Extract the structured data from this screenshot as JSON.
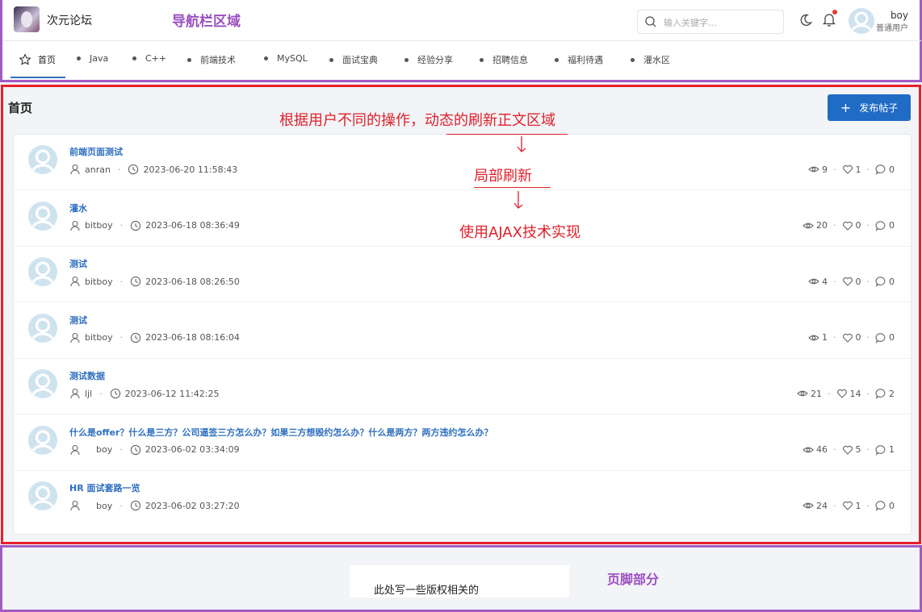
{
  "header": {
    "site_name": "次元论坛",
    "annotation": "导航栏区域",
    "search_placeholder": "输入关键字...",
    "user_name": "boy",
    "user_role": "普通用户"
  },
  "nav": {
    "items": [
      {
        "label": "首页",
        "active": true
      },
      {
        "label": "Java"
      },
      {
        "label": "C++"
      },
      {
        "label": "前端技术"
      },
      {
        "label": "MySQL"
      },
      {
        "label": "面试宝典"
      },
      {
        "label": "经验分享"
      },
      {
        "label": "招聘信息"
      },
      {
        "label": "福利待遇"
      },
      {
        "label": "灌水区"
      }
    ]
  },
  "main": {
    "page_title": "首页",
    "publish_label": "发布帖子",
    "posts": [
      {
        "title": "前端页面测试",
        "author": "anran",
        "time": "2023-06-20 11:58:43",
        "views": "9",
        "likes": "1",
        "comments": "0"
      },
      {
        "title": "灌水",
        "author": "bitboy",
        "time": "2023-06-18 08:36:49",
        "views": "20",
        "likes": "0",
        "comments": "0"
      },
      {
        "title": "测试",
        "author": "bitboy",
        "time": "2023-06-18 08:26:50",
        "views": "4",
        "likes": "0",
        "comments": "0"
      },
      {
        "title": "测试",
        "author": "bitboy",
        "time": "2023-06-18 08:16:04",
        "views": "1",
        "likes": "0",
        "comments": "0"
      },
      {
        "title": "测试数据",
        "author": "ljl",
        "time": "2023-06-12 11:42:25",
        "views": "21",
        "likes": "14",
        "comments": "2"
      },
      {
        "title": "什么是offer？什么是三方？公司逼签三方怎么办？如果三方想毁约怎么办？什么是两方？两方违约怎么办？",
        "author": "boy",
        "time": "2023-06-02 03:34:09",
        "views": "46",
        "likes": "5",
        "comments": "1"
      },
      {
        "title": "HR 面试套路一览",
        "author": "boy",
        "time": "2023-06-02 03:27:20",
        "views": "24",
        "likes": "1",
        "comments": "0"
      }
    ]
  },
  "annotations": {
    "dynamic_refresh": "根据用户不同的操作，动态的刷新正文区域",
    "partial_refresh": "局部刷新",
    "ajax": "使用AJAX技术实现"
  },
  "footer": {
    "copyright_text": "此处写一些版权相关的",
    "annotation": "页脚部分"
  },
  "colors": {
    "accent": "#206bc4",
    "link": "#2f6fbf",
    "annotation_red": "#e0202a",
    "annotation_purple": "#9b4fc0"
  }
}
